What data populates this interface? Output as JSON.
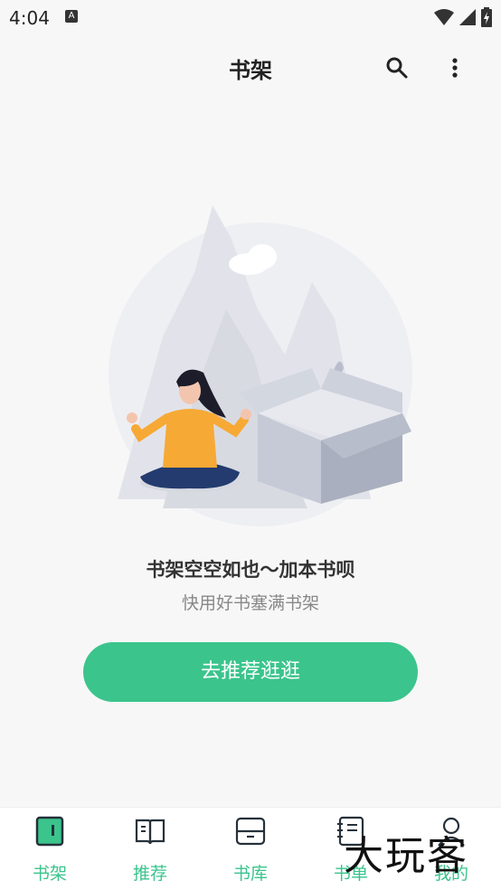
{
  "status_bar": {
    "time": "4:04",
    "notif_icon": "A"
  },
  "header": {
    "title": "书架",
    "search_icon": "search-icon",
    "more_icon": "more-vert-icon"
  },
  "empty_state": {
    "title": "书架空空如也～加本书呗",
    "subtitle": "快用好书塞满书架",
    "cta_label": "去推荐逛逛"
  },
  "bottom_nav": {
    "items": [
      {
        "label": "书架",
        "icon": "bookshelf-icon"
      },
      {
        "label": "推荐",
        "icon": "recommend-book-icon"
      },
      {
        "label": "书库",
        "icon": "library-icon"
      },
      {
        "label": "书单",
        "icon": "booklist-icon"
      },
      {
        "label": "我的",
        "icon": "profile-icon"
      }
    ]
  },
  "watermark": "大玩客",
  "colors": {
    "accent": "#3bc48c",
    "background": "#f7f7f7"
  }
}
